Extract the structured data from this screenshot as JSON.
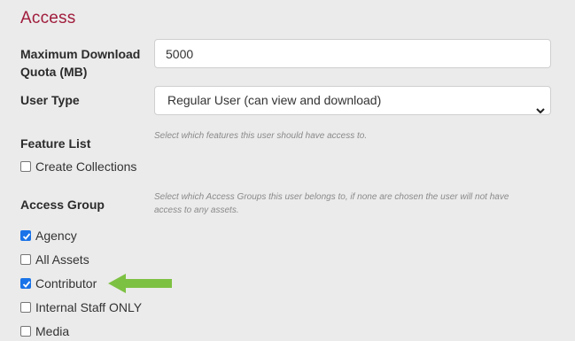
{
  "section": {
    "title": "Access"
  },
  "quota": {
    "label_line1": "Maximum Download",
    "label_line2": "Quota (MB)",
    "value": "5000"
  },
  "user_type": {
    "label": "User Type",
    "selected": "Regular User (can view and download)"
  },
  "feature_list": {
    "label": "Feature List",
    "help": "Select which features this user should have access to.",
    "options": [
      {
        "label": "Create Collections",
        "checked": false
      }
    ]
  },
  "access_group": {
    "label": "Access Group",
    "help_line1": "Select which Access Groups this user belongs to, if none are chosen the user will not have",
    "help_line2": "access to any assets.",
    "options": [
      {
        "label": "Agency",
        "checked": true
      },
      {
        "label": "All Assets",
        "checked": false
      },
      {
        "label": "Contributor",
        "checked": true
      },
      {
        "label": "Internal Staff ONLY",
        "checked": false
      },
      {
        "label": "Media",
        "checked": false
      }
    ]
  },
  "colors": {
    "accent_title": "#a01c3c",
    "checkbox_checked": "#1a73e8",
    "annotation_arrow": "#7dc142"
  },
  "icons": {
    "select_chevron": "chevron-down-icon",
    "annotation": "arrow-left-icon"
  }
}
